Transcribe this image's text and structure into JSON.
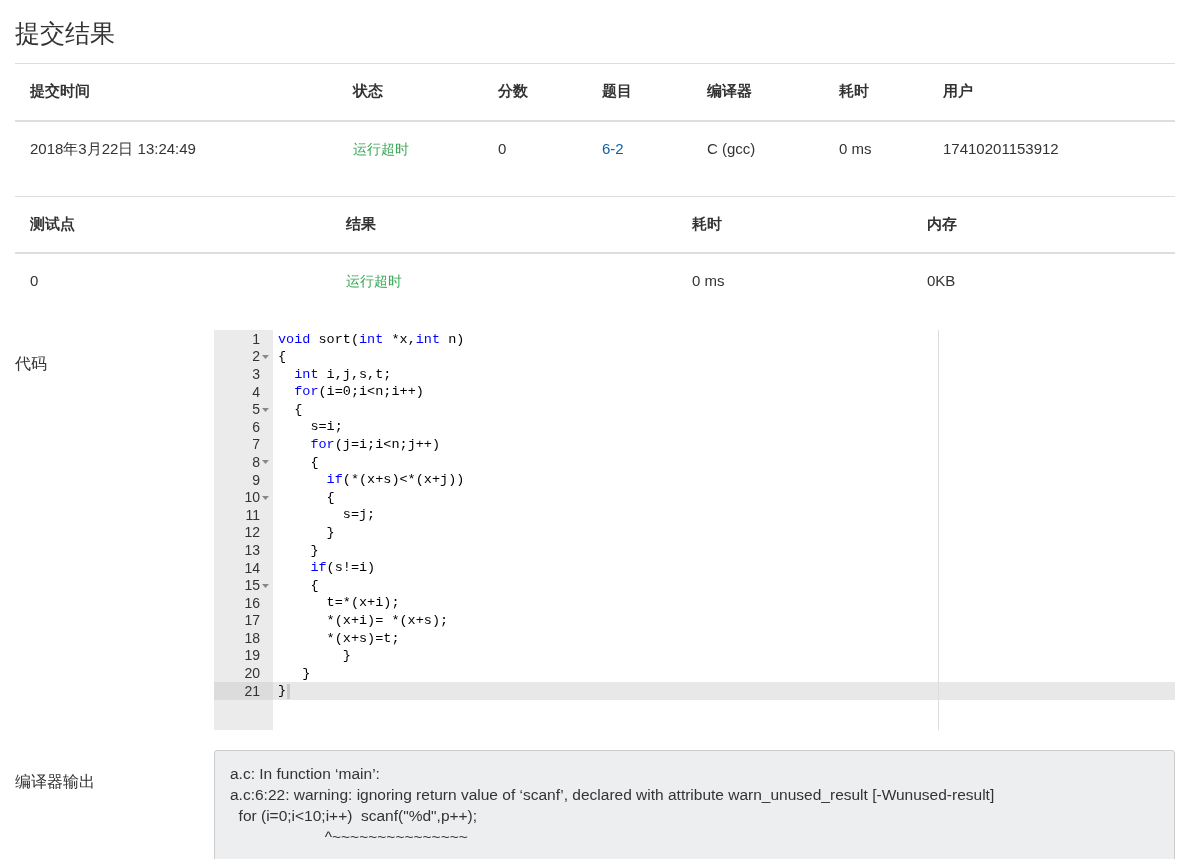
{
  "title": "提交结果",
  "submission": {
    "columns": [
      "提交时间",
      "状态",
      "分数",
      "题目",
      "编译器",
      "耗时",
      "用户"
    ],
    "row": [
      {
        "text": "2018年3月22日 13:24:49",
        "kind": "plain"
      },
      {
        "text": "运行超时",
        "kind": "status"
      },
      {
        "text": "0",
        "kind": "plain"
      },
      {
        "text": "6-2",
        "kind": "link"
      },
      {
        "text": "C (gcc)",
        "kind": "plain"
      },
      {
        "text": "0 ms",
        "kind": "plain"
      },
      {
        "text": "17410201153912",
        "kind": "plain"
      }
    ]
  },
  "testcases": {
    "columns": [
      "测试点",
      "结果",
      "耗时",
      "内存"
    ],
    "rows": [
      [
        {
          "text": "0",
          "kind": "plain"
        },
        {
          "text": "运行超时",
          "kind": "status"
        },
        {
          "text": "0 ms",
          "kind": "plain"
        },
        {
          "text": "0KB",
          "kind": "plain"
        }
      ]
    ]
  },
  "code": {
    "label": "代码",
    "lines": [
      {
        "number": "1",
        "foldable": false,
        "active": false,
        "tokens": [
          {
            "kind": "keyword",
            "text": "void"
          },
          {
            "kind": "plain",
            "text": " sort("
          },
          {
            "kind": "keyword",
            "text": "int"
          },
          {
            "kind": "plain",
            "text": " *x,"
          },
          {
            "kind": "keyword",
            "text": "int"
          },
          {
            "kind": "plain",
            "text": " n)"
          }
        ]
      },
      {
        "number": "2",
        "foldable": true,
        "active": false,
        "tokens": [
          {
            "kind": "plain",
            "text": "{"
          }
        ]
      },
      {
        "number": "3",
        "foldable": false,
        "active": false,
        "tokens": [
          {
            "kind": "keyword",
            "text": "  int"
          },
          {
            "kind": "plain",
            "text": " i,j,s,t;"
          }
        ]
      },
      {
        "number": "4",
        "foldable": false,
        "active": false,
        "tokens": [
          {
            "kind": "keyword",
            "text": "  for"
          },
          {
            "kind": "plain",
            "text": "(i=0;i<n;i++)"
          }
        ]
      },
      {
        "number": "5",
        "foldable": true,
        "active": false,
        "tokens": [
          {
            "kind": "plain",
            "text": "  {"
          }
        ]
      },
      {
        "number": "6",
        "foldable": false,
        "active": false,
        "tokens": [
          {
            "kind": "plain",
            "text": "    s=i;"
          }
        ]
      },
      {
        "number": "7",
        "foldable": false,
        "active": false,
        "tokens": [
          {
            "kind": "keyword",
            "text": "    for"
          },
          {
            "kind": "plain",
            "text": "(j=i;i<n;j++)"
          }
        ]
      },
      {
        "number": "8",
        "foldable": true,
        "active": false,
        "tokens": [
          {
            "kind": "plain",
            "text": "    {"
          }
        ]
      },
      {
        "number": "9",
        "foldable": false,
        "active": false,
        "tokens": [
          {
            "kind": "keyword",
            "text": "      if"
          },
          {
            "kind": "plain",
            "text": "(*(x+s)<*(x+j))"
          }
        ]
      },
      {
        "number": "10",
        "foldable": true,
        "active": false,
        "tokens": [
          {
            "kind": "plain",
            "text": "      {"
          }
        ]
      },
      {
        "number": "11",
        "foldable": false,
        "active": false,
        "tokens": [
          {
            "kind": "plain",
            "text": "        s=j;"
          }
        ]
      },
      {
        "number": "12",
        "foldable": false,
        "active": false,
        "tokens": [
          {
            "kind": "plain",
            "text": "      }"
          }
        ]
      },
      {
        "number": "13",
        "foldable": false,
        "active": false,
        "tokens": [
          {
            "kind": "plain",
            "text": "    }"
          }
        ]
      },
      {
        "number": "14",
        "foldable": false,
        "active": false,
        "tokens": [
          {
            "kind": "keyword",
            "text": "    if"
          },
          {
            "kind": "plain",
            "text": "(s!=i)"
          }
        ]
      },
      {
        "number": "15",
        "foldable": true,
        "active": false,
        "tokens": [
          {
            "kind": "plain",
            "text": "    {"
          }
        ]
      },
      {
        "number": "16",
        "foldable": false,
        "active": false,
        "tokens": [
          {
            "kind": "plain",
            "text": "      t=*(x+i);"
          }
        ]
      },
      {
        "number": "17",
        "foldable": false,
        "active": false,
        "tokens": [
          {
            "kind": "plain",
            "text": "      *(x+i)= *(x+s);"
          }
        ]
      },
      {
        "number": "18",
        "foldable": false,
        "active": false,
        "tokens": [
          {
            "kind": "plain",
            "text": "      *(x+s)=t;"
          }
        ]
      },
      {
        "number": "19",
        "foldable": false,
        "active": false,
        "tokens": [
          {
            "kind": "plain",
            "text": "        }"
          }
        ]
      },
      {
        "number": "20",
        "foldable": false,
        "active": false,
        "tokens": [
          {
            "kind": "plain",
            "text": "   }"
          }
        ]
      },
      {
        "number": "21",
        "foldable": false,
        "active": true,
        "tokens": [
          {
            "kind": "plain",
            "text": "}"
          }
        ]
      }
    ]
  },
  "compiler_output": {
    "label": "编译器输出",
    "lines": [
      "a.c: In function ‘main’:",
      "a.c:6:22: warning: ignoring return value of ‘scanf’, declared with attribute warn_unused_result [-Wunused-result]",
      "  for (i=0;i<10;i++)  scanf(\"%d\",p++);",
      "                      ^~~~~~~~~~~~~~~~"
    ]
  }
}
